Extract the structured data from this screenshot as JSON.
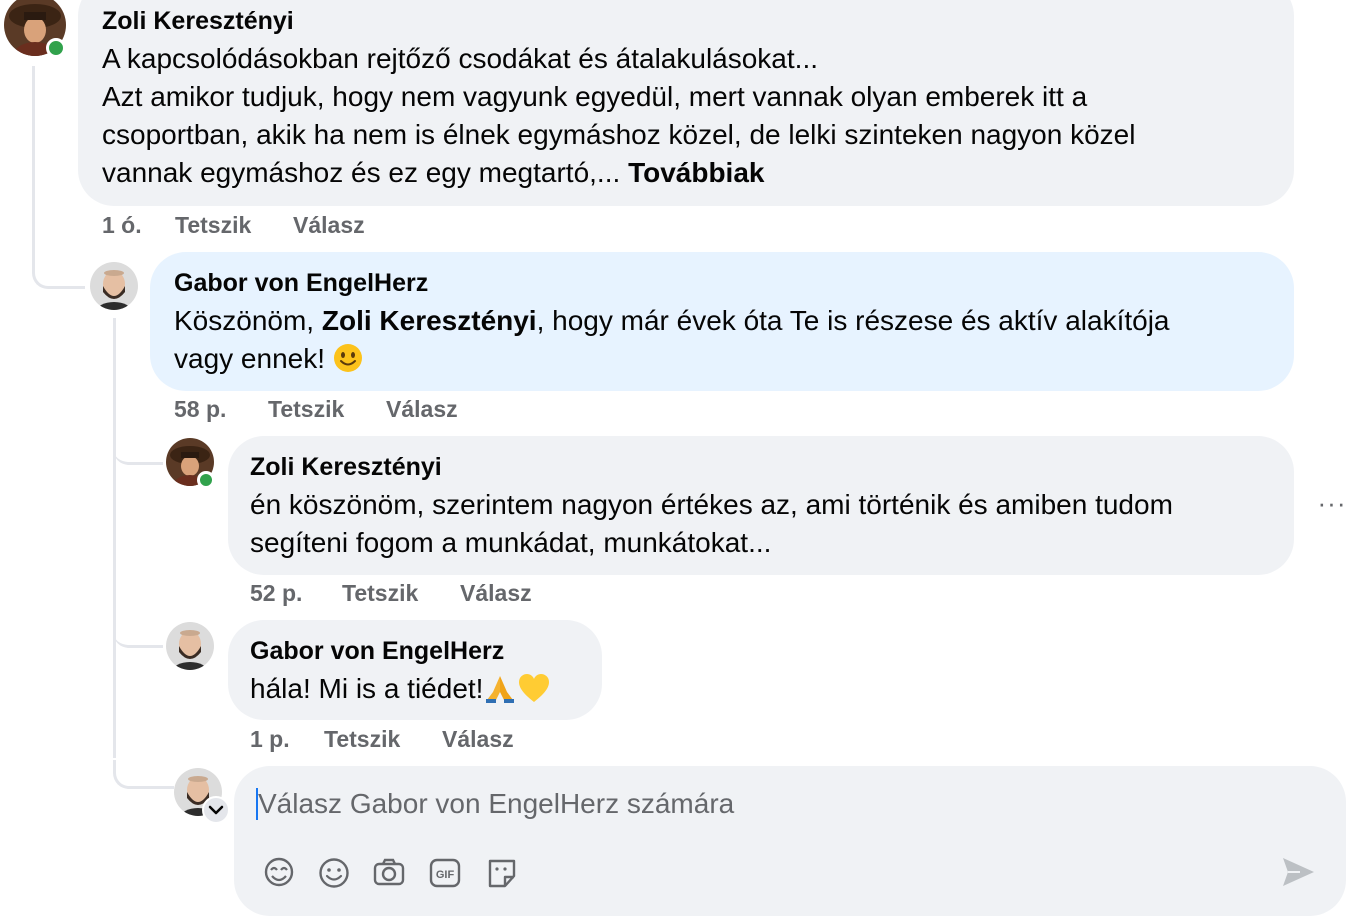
{
  "comments": [
    {
      "author": "Zoli Keresztényi",
      "line1": "A kapcsolódásokban rejtőző csodákat és átalakulásokat...",
      "line2": "Azt amikor tudjuk, hogy nem vagyunk egyedül, mert vannak olyan emberek itt a",
      "line3": "csoportban, akik ha nem is élnek egymáshoz közel, de lelki szinteken nagyon közel",
      "line4": "vannak egymáshoz és ez egy megtartó,...",
      "see_more": "Továbbiak",
      "time": "1 ó.",
      "like": "Tetszik",
      "reply": "Válasz"
    },
    {
      "author": "Gabor von EngelHerz",
      "prefix": "Köszönöm,",
      "mention": "Zoli Keresztényi",
      "suffix": ", hogy már évek óta Te is részese és aktív alakítója",
      "line2": "vagy ennek!",
      "time": "58 p.",
      "like": "Tetszik",
      "reply": "Válasz"
    },
    {
      "author": "Zoli Keresztényi",
      "line1": "én köszönöm, szerintem nagyon értékes az, ami történik és amiben tudom",
      "line2": "segíteni fogom a munkádat, munkátokat...",
      "time": "52 p.",
      "like": "Tetszik",
      "reply": "Válasz"
    },
    {
      "author": "Gabor von EngelHerz",
      "text": "hála! Mi is a tiédet!",
      "time": "1 p.",
      "like": "Tetszik",
      "reply": "Válasz"
    }
  ],
  "more_options": "···",
  "reply_box": {
    "placeholder": "Válasz Gabor von EngelHerz számára",
    "icons": [
      "avatar-sticker-icon",
      "emoji-icon",
      "camera-icon",
      "gif-icon",
      "sticker-icon",
      "send-icon"
    ]
  },
  "colors": {
    "bubble": "#f0f2f5",
    "highlight_bubble": "#e7f3ff",
    "meta_text": "#65676b",
    "online": "#31a24c",
    "thread_line": "#e4e6eb"
  }
}
